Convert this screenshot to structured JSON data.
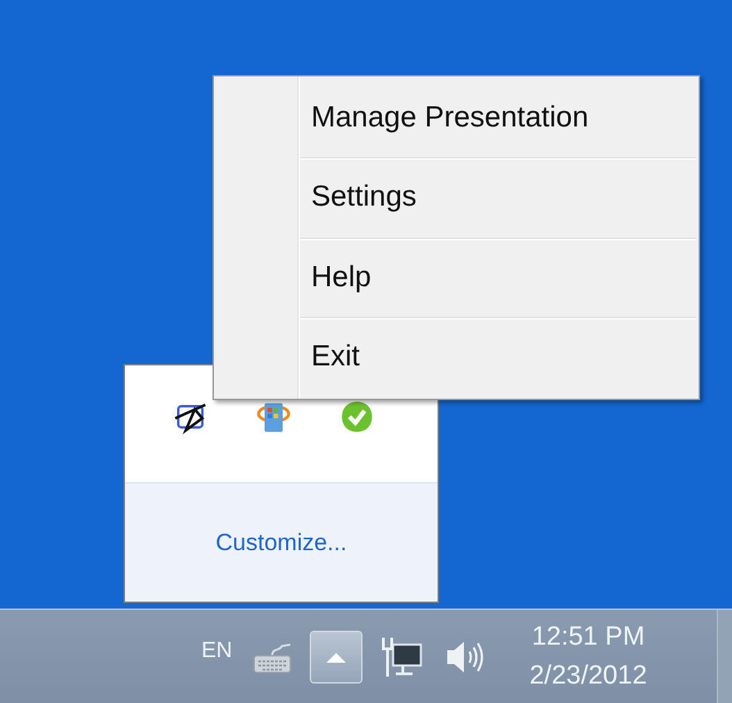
{
  "context_menu": {
    "items": [
      {
        "label": "Manage Presentation"
      },
      {
        "label": "Settings"
      },
      {
        "label": "Help"
      },
      {
        "label": "Exit"
      }
    ]
  },
  "tray_overflow": {
    "link": "Customize..."
  },
  "taskbar": {
    "language": "EN",
    "overflow_expanded": true,
    "time": "12:51 PM",
    "date": "2/23/2012"
  }
}
